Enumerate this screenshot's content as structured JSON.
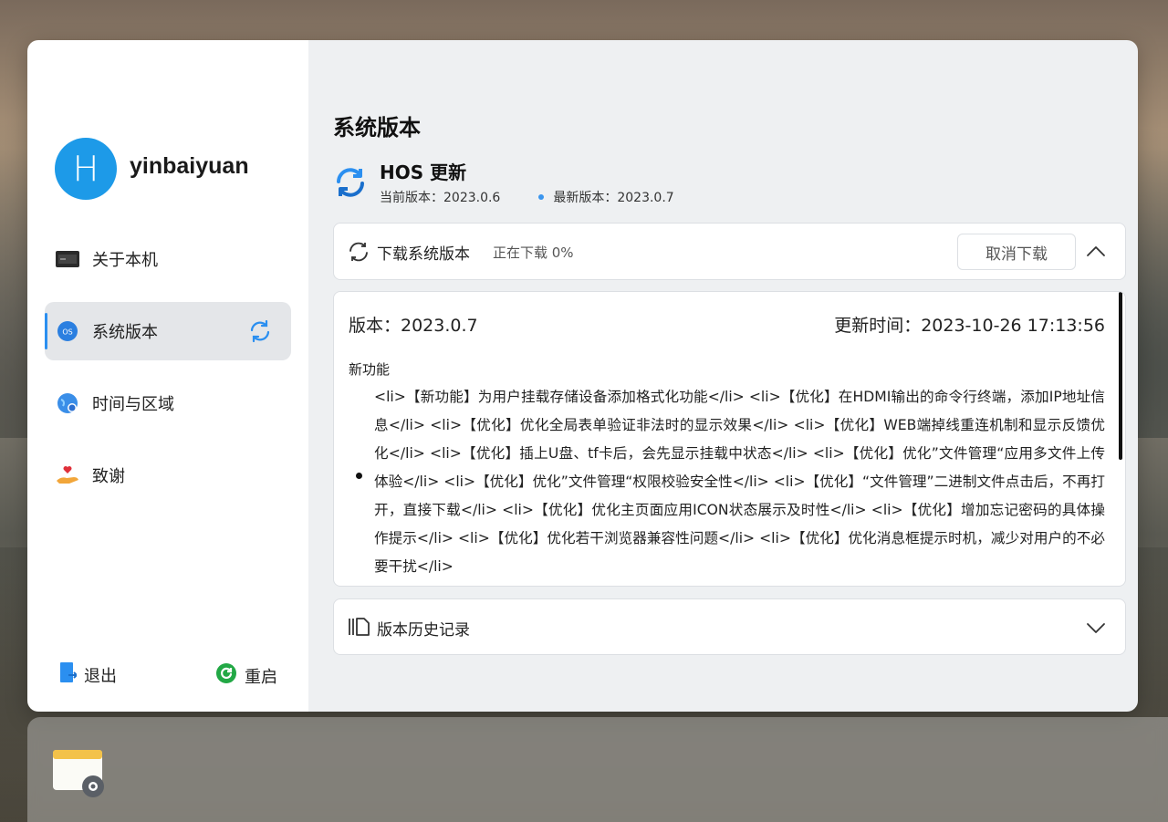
{
  "user": {
    "avatar_letter": "H",
    "name": "yinbaiyuan"
  },
  "sidebar": {
    "items": [
      {
        "label": "关于本机",
        "icon": "device-icon"
      },
      {
        "label": "系统版本",
        "icon": "os-icon",
        "active": true,
        "badge_icon": "sync-icon"
      },
      {
        "label": "时间与区域",
        "icon": "globe-icon"
      },
      {
        "label": "致谢",
        "icon": "heart-hand-icon"
      }
    ],
    "logout_label": "退出",
    "restart_label": "重启"
  },
  "main": {
    "title": "系统版本",
    "update": {
      "title": "HOS 更新",
      "current_version": "当前版本：2023.0.6",
      "latest_version": "最新版本：2023.0.7"
    },
    "download": {
      "label": "下载系统版本",
      "status": "正在下载 0%",
      "cancel_label": "取消下载"
    },
    "release": {
      "version": "版本：2023.0.7",
      "update_time": "更新时间：2023-10-26 17:13:56",
      "section": "新功能",
      "notes": "<li>【新功能】为用户挂载存储设备添加格式化功能</li> <li>【优化】在HDMI输出的命令行终端，添加IP地址信息</li> <li>【优化】优化全局表单验证非法时的显示效果</li> <li>【优化】WEB端掉线重连机制和显示反馈优化</li> <li>【优化】插上U盘、tf卡后，会先显示挂载中状态</li> <li>【优化】优化”文件管理“应用多文件上传体验</li> <li>【优化】优化”文件管理“权限校验安全性</li> <li>【优化】“文件管理”二进制文件点击后，不再打开，直接下载</li> <li>【优化】优化主页面应用ICON状态展示及时性</li> <li>【优化】增加忘记密码的具体操作提示</li> <li>【优化】优化若干浏览器兼容性问题</li> <li>【优化】优化消息框提示时机，减少对用户的不必要干扰</li>"
    },
    "history": {
      "label": "版本历史记录"
    }
  },
  "colors": {
    "accent": "#2b8ff0",
    "avatar": "#1d9ae8",
    "restart": "#22a845"
  }
}
